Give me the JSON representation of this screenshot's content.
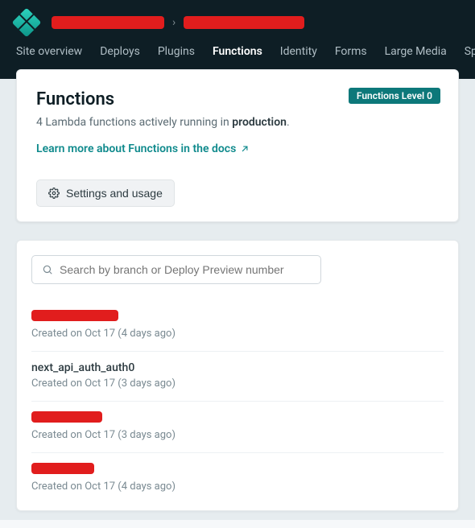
{
  "breadcrumb": {
    "separator": "›"
  },
  "nav": {
    "items": [
      {
        "label": "Site overview",
        "active": false
      },
      {
        "label": "Deploys",
        "active": false
      },
      {
        "label": "Plugins",
        "active": false
      },
      {
        "label": "Functions",
        "active": true
      },
      {
        "label": "Identity",
        "active": false
      },
      {
        "label": "Forms",
        "active": false
      },
      {
        "label": "Large Media",
        "active": false
      },
      {
        "label": "Split Tes",
        "active": false
      }
    ]
  },
  "hero": {
    "title": "Functions",
    "subtitle_prefix": "4 Lambda functions actively running in ",
    "subtitle_env": "production",
    "subtitle_suffix": ".",
    "badge": "Functions Level 0",
    "learn_more": "Learn more about Functions in the docs",
    "settings_button": "Settings and usage"
  },
  "search": {
    "placeholder": "Search by branch or Deploy Preview number"
  },
  "functions": [
    {
      "name_redacted": true,
      "red_width": 108,
      "name": "",
      "meta": "Created on Oct 17 (4 days ago)"
    },
    {
      "name_redacted": false,
      "red_width": 0,
      "name": "next_api_auth_auth0",
      "meta": "Created on Oct 17 (3 days ago)"
    },
    {
      "name_redacted": true,
      "red_width": 88,
      "name": "",
      "meta": "Created on Oct 17 (3 days ago)"
    },
    {
      "name_redacted": true,
      "red_width": 78,
      "name": "",
      "meta": "Created on Oct 17 (4 days ago)"
    }
  ]
}
